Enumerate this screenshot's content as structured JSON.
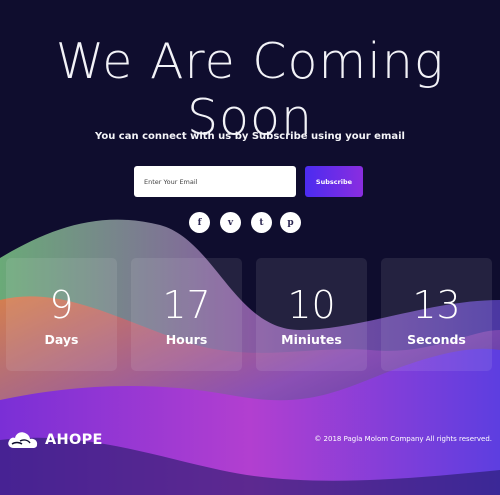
{
  "page": {
    "title": "We Are Coming Soon",
    "subtitle": "You can connect with us by Subscribe using your email"
  },
  "subscribe": {
    "placeholder": "Enter Your Email",
    "button_label": "Subscribe"
  },
  "social": [
    {
      "icon": "facebook-icon",
      "glyph": "f"
    },
    {
      "icon": "vimeo-icon",
      "glyph": "v"
    },
    {
      "icon": "twitter-icon",
      "glyph": "t"
    },
    {
      "icon": "pinterest-icon",
      "glyph": "p"
    }
  ],
  "countdown": [
    {
      "value": "9",
      "label": "Days"
    },
    {
      "value": "17",
      "label": "Hours"
    },
    {
      "value": "10",
      "label": "Miniutes"
    },
    {
      "value": "13",
      "label": "Seconds"
    }
  ],
  "footer": {
    "logo_text": "AHOPE",
    "copyright": "© 2018 Pagla Molom Company All rights reserved."
  },
  "colors": {
    "background": "#0f0d2e",
    "accent": "#6a2ee6"
  }
}
